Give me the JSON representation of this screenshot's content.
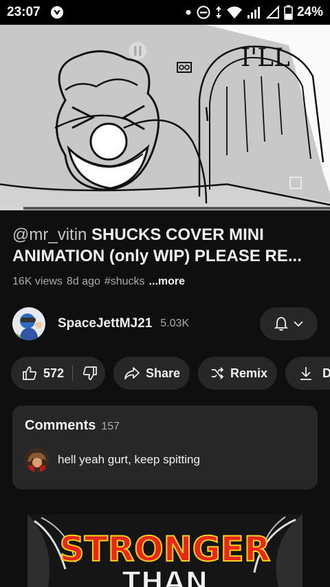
{
  "status_bar": {
    "time": "23:07",
    "battery": "24%",
    "icons": [
      "shield-app-icon",
      "dot-icon",
      "do-not-disturb-icon",
      "data-arrows-icon",
      "wifi-icon",
      "signal-icon",
      "signal-outline-icon",
      "battery-icon"
    ]
  },
  "video": {
    "caption_text": "I'LL",
    "progress": 0.07,
    "title_handle": "@mr_vitin",
    "title_text": " SHUCKS COVER MINI ANIMATION (only WIP) PLEASE RE...",
    "views": "16K views",
    "age": "8d ago",
    "hashtag": "#shucks",
    "more_label": "...more"
  },
  "channel": {
    "name": "SpaceJettMJ21",
    "subscribers": "5.03K"
  },
  "actions": {
    "likes": "572",
    "share_label": "Share",
    "remix_label": "Remix",
    "download_label": "Download"
  },
  "comments": {
    "title": "Comments",
    "count": "157",
    "top_comment": "hell yeah gurt, keep spitting"
  },
  "next_video": {
    "thumbnail_text_1": "STRONGER",
    "thumbnail_text_2": "THAN"
  }
}
